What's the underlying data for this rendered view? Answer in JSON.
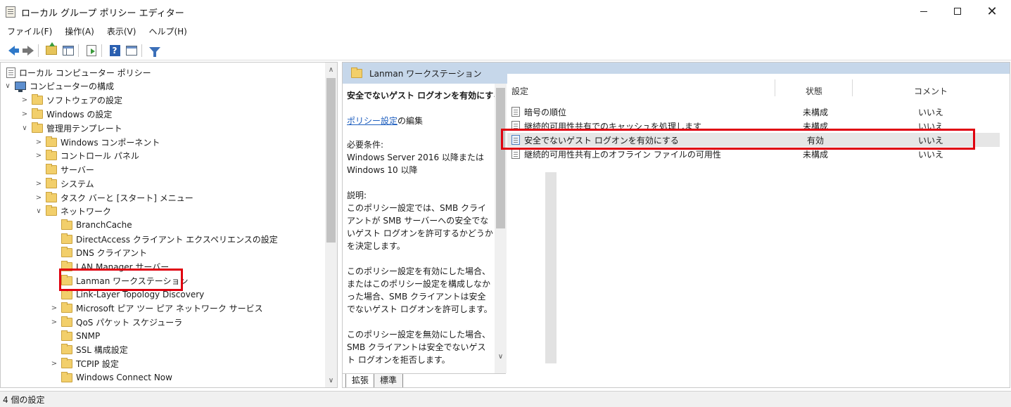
{
  "window": {
    "title": "ローカル グループ ポリシー エディター",
    "minimize_icon": "minimize-icon",
    "maximize_icon": "maximize-icon",
    "close_glyph": "✕"
  },
  "menu": [
    "ファイル(F)",
    "操作(A)",
    "表示(V)",
    "ヘルプ(H)"
  ],
  "toolbar": {
    "icons": [
      "back-arrow-icon",
      "forward-arrow-icon",
      "up-folder-icon",
      "show-hide-tree-icon",
      "export-list-icon",
      "help-icon",
      "view-icon",
      "filter-icon"
    ],
    "help_glyph": "?"
  },
  "tree": {
    "chevron_expanded": "∨",
    "chevron_collapsed": ">",
    "items": [
      {
        "label": "ローカル コンピューター ポリシー",
        "icon": "policy-document-icon",
        "chevron": ""
      },
      {
        "label": "コンピューターの構成",
        "icon": "computer-icon",
        "chevron": "∨"
      },
      {
        "label": "ソフトウェアの設定",
        "icon": "folder-icon",
        "chevron": ">"
      },
      {
        "label": "Windows の設定",
        "icon": "folder-icon",
        "chevron": ">"
      },
      {
        "label": "管理用テンプレート",
        "icon": "folder-icon",
        "chevron": "∨"
      },
      {
        "label": "Windows コンポーネント",
        "icon": "folder-icon",
        "chevron": ">"
      },
      {
        "label": "コントロール パネル",
        "icon": "folder-icon",
        "chevron": ">"
      },
      {
        "label": "サーバー",
        "icon": "folder-icon",
        "chevron": ""
      },
      {
        "label": "システム",
        "icon": "folder-icon",
        "chevron": ">"
      },
      {
        "label": "タスク バーと [スタート] メニュー",
        "icon": "folder-icon",
        "chevron": ">"
      },
      {
        "label": "ネットワーク",
        "icon": "folder-icon",
        "chevron": "∨"
      },
      {
        "label": "BranchCache",
        "icon": "folder-icon",
        "chevron": ""
      },
      {
        "label": "DirectAccess クライアント エクスペリエンスの設定",
        "icon": "folder-icon",
        "chevron": ""
      },
      {
        "label": "DNS クライアント",
        "icon": "folder-icon",
        "chevron": ""
      },
      {
        "label": "LAN Manager サーバー",
        "icon": "folder-icon",
        "chevron": ""
      },
      {
        "label": "Lanman ワークステーション",
        "icon": "folder-icon",
        "chevron": "",
        "selected": true
      },
      {
        "label": "Link-Layer Topology Discovery",
        "icon": "folder-icon",
        "chevron": ""
      },
      {
        "label": "Microsoft ピア ツー ピア ネットワーク サービス",
        "icon": "folder-icon",
        "chevron": ">"
      },
      {
        "label": "QoS パケット スケジューラ",
        "icon": "folder-icon",
        "chevron": ">"
      },
      {
        "label": "SNMP",
        "icon": "folder-icon",
        "chevron": ""
      },
      {
        "label": "SSL 構成設定",
        "icon": "folder-icon",
        "chevron": ""
      },
      {
        "label": "TCPIP 設定",
        "icon": "folder-icon",
        "chevron": ">"
      },
      {
        "label": "Windows Connect Now",
        "icon": "folder-icon",
        "chevron": ""
      }
    ],
    "scroll_up": "∧",
    "scroll_down": "∨"
  },
  "right": {
    "header": "Lanman ワークステーション",
    "description": {
      "title": "安全でないゲスト ログオンを有効にする",
      "edit_link": "ポリシー設定",
      "edit_suffix": "の編集",
      "body": "必要条件:\nWindows Server 2016 以降または Windows 10 以降\n\n説明:\nこのポリシー設定では、SMB クライアントが SMB サーバーへの安全でないゲスト ログオンを許可するかどうかを決定します。\n\nこのポリシー設定を有効にした場合、またはこのポリシー設定を構成しなかった場合、SMB クライアントは安全でないゲスト ログオンを許可します。\n\nこのポリシー設定を無効にした場合、SMB クライアントは安全でないゲスト ログオンを拒否します。\n\n安全でないゲスト ログオンがファイル サーバーによって使用されるのは、共有フォ",
      "scroll_down": "∨"
    },
    "columns": {
      "name": "設定",
      "state": "状態",
      "comment": "コメント"
    },
    "rows": [
      {
        "name": "暗号の順位",
        "state": "未構成",
        "comment": "いいえ"
      },
      {
        "name": "継続的可用性共有でのキャッシュを処理します",
        "state": "未構成",
        "comment": "いいえ"
      },
      {
        "name": "安全でないゲスト ログオンを有効にする",
        "state": "有効",
        "comment": "いいえ",
        "selected": true
      },
      {
        "name": "継続的可用性共有上のオフライン ファイルの可用性",
        "state": "未構成",
        "comment": "いいえ"
      }
    ],
    "tabs": {
      "extended": "拡張",
      "standard": "標準"
    }
  },
  "status": "4 個の設定",
  "colors": {
    "header_bg": "#c6d7ea",
    "highlight": "#e0000f",
    "link": "#1f5fbf",
    "selected_row": "#e6e6e6"
  }
}
